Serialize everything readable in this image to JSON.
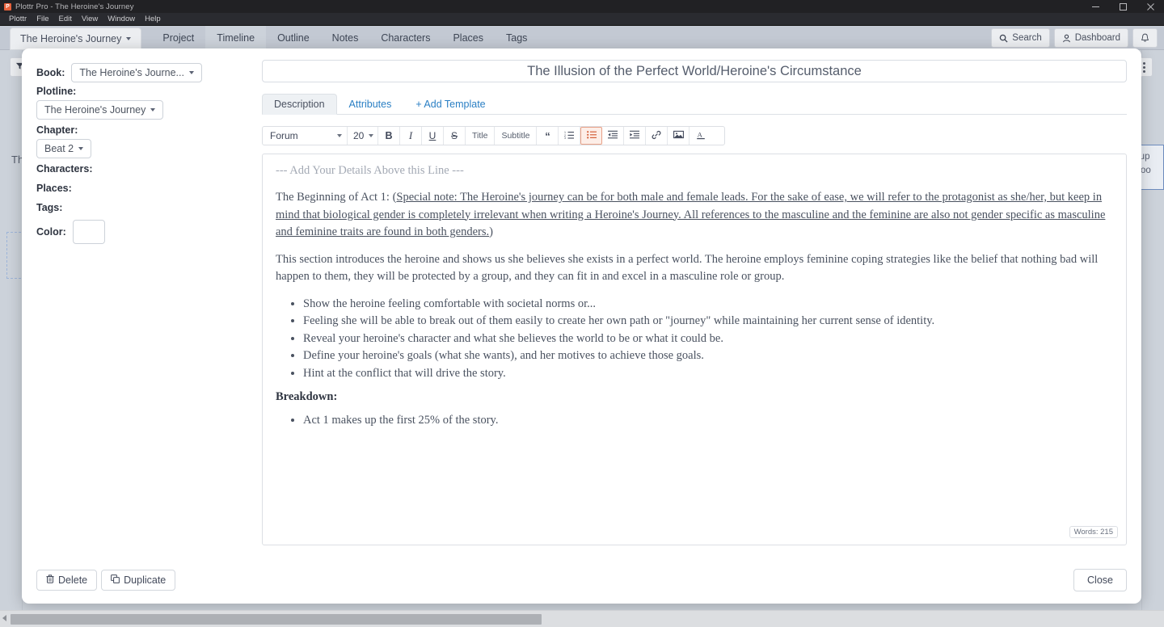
{
  "window": {
    "title": "Plottr Pro - The Heroine's Journey",
    "app_icon": "plottr-logo-icon",
    "controls": [
      "minimize",
      "maximize",
      "close"
    ]
  },
  "menubar": {
    "items": [
      "Plottr",
      "File",
      "Edit",
      "View",
      "Window",
      "Help"
    ]
  },
  "navbar": {
    "book_selector": "The Heroine's Journey",
    "tabs": [
      {
        "label": "Project",
        "active": false
      },
      {
        "label": "Timeline",
        "active": true
      },
      {
        "label": "Outline",
        "active": false
      },
      {
        "label": "Notes",
        "active": false
      },
      {
        "label": "Characters",
        "active": false
      },
      {
        "label": "Places",
        "active": false
      },
      {
        "label": "Tags",
        "active": false
      }
    ],
    "search_label": "Search",
    "dashboard_label": "Dashboard",
    "notification_icon": "bell-icon"
  },
  "background": {
    "filter_icon": "filter-icon",
    "kebab_icon": "more-options-icon",
    "partial_label": "Th",
    "card_line1": "Sup",
    "card_line2": "Goo"
  },
  "modal": {
    "sidebar": {
      "book_label": "Book:",
      "book_value": "The Heroine's Journe...",
      "plotline_label": "Plotline:",
      "plotline_value": "The Heroine's Journey",
      "chapter_label": "Chapter:",
      "chapter_value": "Beat 2",
      "characters_label": "Characters:",
      "places_label": "Places:",
      "tags_label": "Tags:",
      "color_label": "Color:",
      "color_value": "#ffffff"
    },
    "title": "The Illusion of the Perfect World/Heroine's Circumstance",
    "tabs": [
      {
        "label": "Description",
        "active": true
      },
      {
        "label": "Attributes",
        "active": false
      },
      {
        "label": "+ Add Template",
        "active": false
      }
    ],
    "toolbar": {
      "font": "Forum",
      "size": "20",
      "bold": "B",
      "italic": "I",
      "underline": "U",
      "strike": "S",
      "title_btn": "Title",
      "subtitle_btn": "Subtitle",
      "quote_icon": "blockquote-icon",
      "ordered_list_icon": "ordered-list-icon",
      "bullet_list_icon": "bullet-list-icon",
      "outdent_icon": "outdent-icon",
      "indent_icon": "indent-icon",
      "link_icon": "link-icon",
      "image_icon": "image-icon",
      "text_color_icon": "text-color-icon"
    },
    "editor": {
      "hint": "--- Add Your Details Above this Line ---",
      "para1_lead": "The Beginning of Act 1: (",
      "para1_underlined": "Special note: The Heroine's journey can be for both male and female leads. For the sake of ease, we will refer to the protagonist as she/her, but keep in mind that biological gender is completely irrelevant when writing a Heroine's Journey. All references to the masculine and the feminine are also not gender specific as masculine and feminine traits are found in both genders.",
      "para1_tail": ")",
      "para2": "This section introduces the heroine and shows us she believes she exists in a perfect world. The heroine employs feminine coping strategies like the belief that nothing bad will happen to them, they will be protected by a group, and they can fit in and excel in a masculine role or group.",
      "bullets": [
        "Show the heroine feeling comfortable with societal norms or...",
        "Feeling she will be able to break out of them easily to create her own path or \"journey\" while maintaining her current sense of identity.",
        "Reveal your heroine's character and what she believes the world to be or what it could be.",
        "Define your heroine's goals (what she wants), and her motives to achieve those goals.",
        "Hint at the conflict that will drive the story."
      ],
      "breakdown_heading": "Breakdown:",
      "breakdown_bullets": [
        "Act 1 makes up the first 25% of the story."
      ],
      "wordcount": "Words: 215"
    },
    "footer": {
      "delete_label": "Delete",
      "delete_icon": "trash-icon",
      "duplicate_label": "Duplicate",
      "duplicate_icon": "copy-icon",
      "close_label": "Close"
    }
  },
  "colors": {
    "accent_blue": "#2a7fc4",
    "chrome_dark": "#212124",
    "app_bg": "#ccd2da",
    "selected_tool": "#e8a188"
  }
}
